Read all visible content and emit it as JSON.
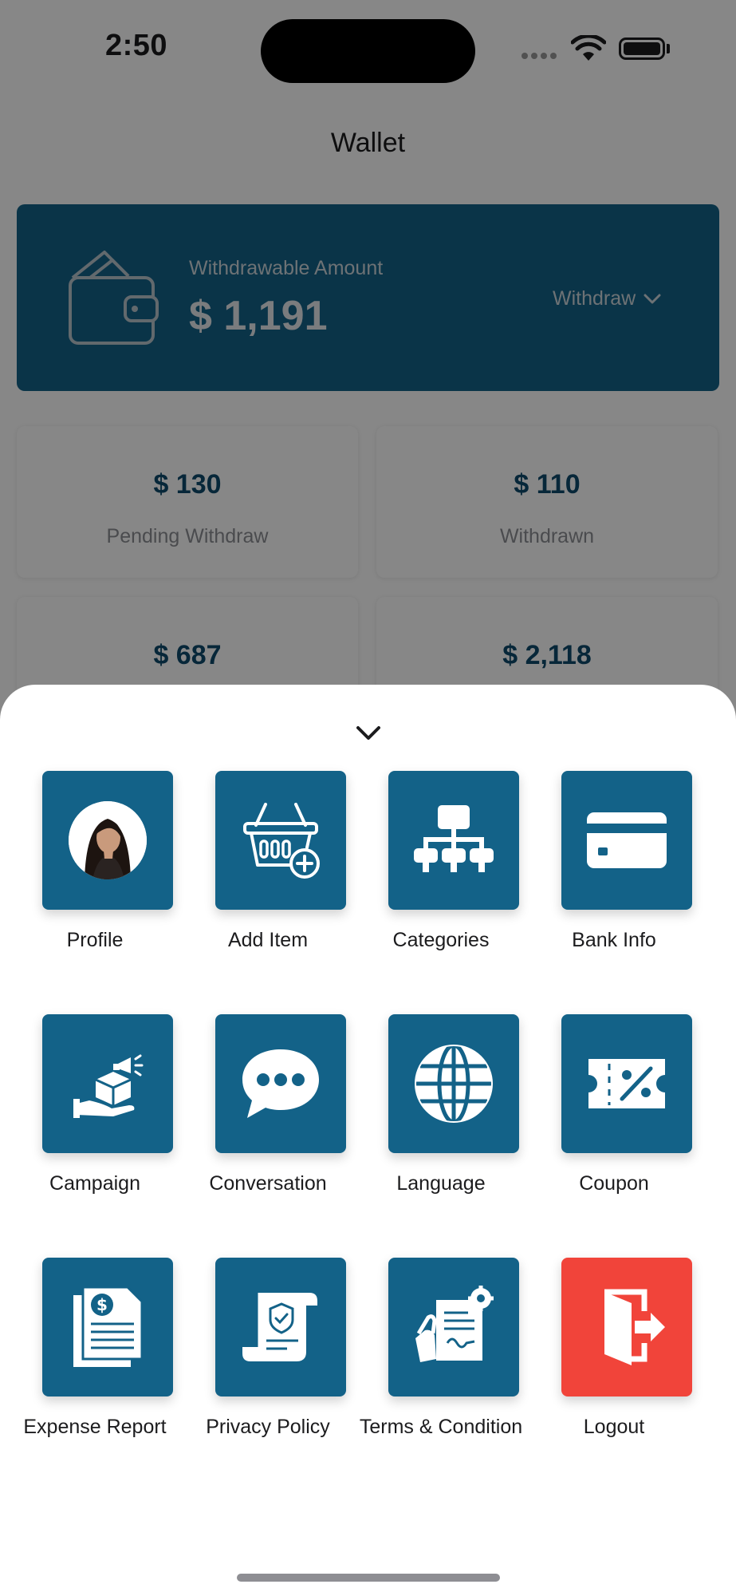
{
  "status_bar": {
    "time": "2:50"
  },
  "header": {
    "title": "Wallet"
  },
  "wallet_card": {
    "label": "Withdrawable Amount",
    "amount": "$ 1,191",
    "withdraw_label": "Withdraw",
    "icon": "wallet-icon"
  },
  "stats": [
    {
      "value": "$ 130",
      "label": "Pending Withdraw"
    },
    {
      "value": "$ 110",
      "label": "Withdrawn"
    },
    {
      "value": "$ 687",
      "label": ""
    },
    {
      "value": "$ 2,118",
      "label": ""
    }
  ],
  "menu": {
    "items": [
      {
        "label": "Profile",
        "icon": "avatar"
      },
      {
        "label": "Add Item",
        "icon": "basket-add-icon"
      },
      {
        "label": "Categories",
        "icon": "hierarchy-icon"
      },
      {
        "label": "Bank Info",
        "icon": "credit-card-icon"
      },
      {
        "label": "Campaign",
        "icon": "campaign-icon"
      },
      {
        "label": "Conversation",
        "icon": "chat-bubble-icon"
      },
      {
        "label": "Language",
        "icon": "globe-icon"
      },
      {
        "label": "Coupon",
        "icon": "coupon-icon"
      },
      {
        "label": "Expense Report",
        "icon": "expense-report-icon"
      },
      {
        "label": "Privacy Policy",
        "icon": "privacy-policy-icon"
      },
      {
        "label": "Terms & Condition",
        "icon": "terms-contract-icon"
      },
      {
        "label": "Logout",
        "icon": "logout-icon"
      }
    ]
  },
  "colors": {
    "primary": "#136288",
    "logout": "#f1443a",
    "stat_value": "#0e4a6d"
  }
}
